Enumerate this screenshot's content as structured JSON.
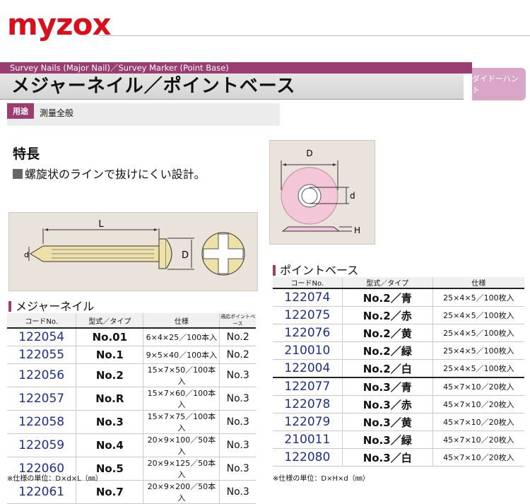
{
  "brand": "myzox",
  "header": {
    "subtitle": "Survey Nails (Major Nail)／Survey Marker (Point Base)",
    "title": "メジャーネイル／ポイントベース",
    "category_tag": "ダイドーハント",
    "use_label": "用途",
    "use_text": "測量全般"
  },
  "features": {
    "heading": "特長",
    "text": "螺旋状のラインで抜けにくい設計。"
  },
  "diagram_nail": {
    "L": "L",
    "D": "D",
    "d": "d"
  },
  "diagram_base": {
    "D": "D",
    "d": "d",
    "H": "H"
  },
  "major_nail": {
    "heading": "メジャーネイル",
    "columns": [
      "コードNo.",
      "型式／タイプ",
      "仕様",
      "適応ポイントベース"
    ],
    "rows": [
      [
        "122054",
        "No.01",
        "6×4×25／100本入",
        "No.2"
      ],
      [
        "122055",
        "No.1",
        "9×5×40／100本入",
        "No.2"
      ],
      [
        "122056",
        "No.2",
        "15×7×50／100本入",
        "No.3"
      ],
      [
        "122057",
        "No.R",
        "15×7×60／100本入",
        "No.3"
      ],
      [
        "122058",
        "No.3",
        "15×7×75／100本入",
        "No.3"
      ],
      [
        "122059",
        "No.4",
        "20×9×100／50本入",
        "No.3"
      ],
      [
        "122060",
        "No.5",
        "20×9×125／50本入",
        "No.3"
      ],
      [
        "122061",
        "No.7",
        "20×9×200／50本入",
        "No.3"
      ]
    ],
    "note": "※仕様の単位：D×d×L（㎜）"
  },
  "point_base": {
    "heading": "ポイントベース",
    "columns": [
      "コードNo.",
      "型式／タイプ",
      "仕様"
    ],
    "rows": [
      [
        "122074",
        "No.2／青",
        "25×4×5／100枚入"
      ],
      [
        "122075",
        "No.2／赤",
        "25×4×5／100枚入"
      ],
      [
        "122076",
        "No.2／黄",
        "25×4×5／100枚入"
      ],
      [
        "210010",
        "No.2／緑",
        "25×4×5／100枚入"
      ],
      [
        "122004",
        "No.2／白",
        "25×4×5／100枚入"
      ],
      [
        "122077",
        "No.3／青",
        "45×7×10／20枚入"
      ],
      [
        "122078",
        "No.3／赤",
        "45×7×10／20枚入"
      ],
      [
        "122079",
        "No.3／黄",
        "45×7×10／20枚入"
      ],
      [
        "210011",
        "No.3／緑",
        "45×7×10／20枚入"
      ],
      [
        "122080",
        "No.3／白",
        "45×7×10／20枚入"
      ]
    ],
    "note": "※仕様の単位：D×H×d（㎜）"
  },
  "colors": {
    "brand_red": "#d8101d",
    "accent": "#9a3e72",
    "code_blue": "#1d2f86"
  }
}
